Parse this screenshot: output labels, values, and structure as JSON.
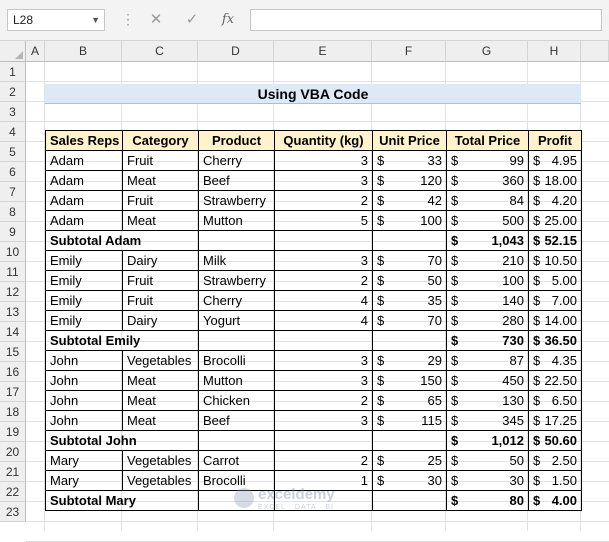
{
  "formula_bar": {
    "name_box": "L28",
    "cancel_icon": "✕",
    "enter_icon": "✓",
    "fx_label": "fx",
    "formula": ""
  },
  "columns": [
    "A",
    "B",
    "C",
    "D",
    "E",
    "F",
    "G",
    "H"
  ],
  "rows": [
    "1",
    "2",
    "3",
    "4",
    "5",
    "6",
    "7",
    "8",
    "9",
    "10",
    "11",
    "12",
    "13",
    "14",
    "15",
    "16",
    "17",
    "18",
    "19",
    "20",
    "21",
    "22",
    "23"
  ],
  "title": "Using VBA Code",
  "table": {
    "headers": [
      "Sales Reps",
      "Category",
      "Product",
      "Quantity (kg)",
      "Unit Price",
      "Total Price",
      "Profit"
    ],
    "rows": [
      {
        "rep": "Adam",
        "category": "Fruit",
        "product": "Cherry",
        "qty": "3",
        "unit": "33",
        "total": "99",
        "profit": "4.95"
      },
      {
        "rep": "Adam",
        "category": "Meat",
        "product": "Beef",
        "qty": "3",
        "unit": "120",
        "total": "360",
        "profit": "18.00"
      },
      {
        "rep": "Adam",
        "category": "Fruit",
        "product": "Strawberry",
        "qty": "2",
        "unit": "42",
        "total": "84",
        "profit": "4.20"
      },
      {
        "rep": "Adam",
        "category": "Meat",
        "product": "Mutton",
        "qty": "5",
        "unit": "100",
        "total": "500",
        "profit": "25.00"
      },
      {
        "subtotal": "Subtotal Adam",
        "total": "1,043",
        "profit": "52.15"
      },
      {
        "rep": "Emily",
        "category": "Dairy",
        "product": "Milk",
        "qty": "3",
        "unit": "70",
        "total": "210",
        "profit": "10.50"
      },
      {
        "rep": "Emily",
        "category": "Fruit",
        "product": "Strawberry",
        "qty": "2",
        "unit": "50",
        "total": "100",
        "profit": "5.00"
      },
      {
        "rep": "Emily",
        "category": "Fruit",
        "product": "Cherry",
        "qty": "4",
        "unit": "35",
        "total": "140",
        "profit": "7.00"
      },
      {
        "rep": "Emily",
        "category": "Dairy",
        "product": "Yogurt",
        "qty": "4",
        "unit": "70",
        "total": "280",
        "profit": "14.00"
      },
      {
        "subtotal": "Subtotal Emily",
        "total": "730",
        "profit": "36.50"
      },
      {
        "rep": "John",
        "category": "Vegetables",
        "product": "Brocolli",
        "qty": "3",
        "unit": "29",
        "total": "87",
        "profit": "4.35"
      },
      {
        "rep": "John",
        "category": "Meat",
        "product": "Mutton",
        "qty": "3",
        "unit": "150",
        "total": "450",
        "profit": "22.50"
      },
      {
        "rep": "John",
        "category": "Meat",
        "product": "Chicken",
        "qty": "2",
        "unit": "65",
        "total": "130",
        "profit": "6.50"
      },
      {
        "rep": "John",
        "category": "Meat",
        "product": "Beef",
        "qty": "3",
        "unit": "115",
        "total": "345",
        "profit": "17.25"
      },
      {
        "subtotal": "Subtotal John",
        "total": "1,012",
        "profit": "50.60"
      },
      {
        "rep": "Mary",
        "category": "Vegetables",
        "product": "Carrot",
        "qty": "2",
        "unit": "25",
        "total": "50",
        "profit": "2.50"
      },
      {
        "rep": "Mary",
        "category": "Vegetables",
        "product": "Brocolli",
        "qty": "1",
        "unit": "30",
        "total": "30",
        "profit": "1.50"
      },
      {
        "subtotal": "Subtotal Mary",
        "total": "80",
        "profit": "4.00"
      }
    ]
  },
  "currency_symbol": "$",
  "watermark": {
    "brand": "exceldemy",
    "tagline": "EXCEL · DATA · BI"
  }
}
